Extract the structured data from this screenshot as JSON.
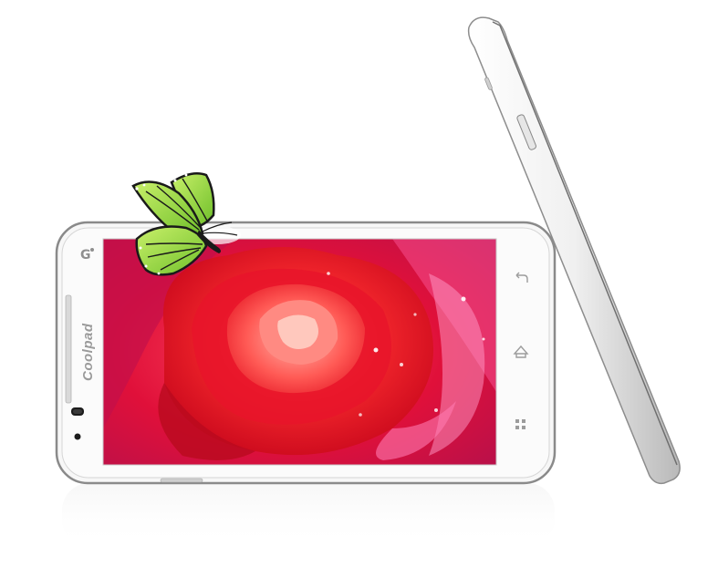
{
  "phone": {
    "brand_logo": "Coolpad",
    "front_mark": "G"
  },
  "colors": {
    "background": "#ffffff",
    "phone_body": "#f7f7f7",
    "phone_bezel": "#9a9a9a",
    "screen_rose": "#e8142a",
    "screen_background": "#d41436",
    "butterfly_wing": "#8fd23a"
  },
  "icons": {
    "nav_back": "back-arrow-icon",
    "nav_home": "home-icon",
    "nav_menu": "menu-grid-icon",
    "front_camera": "front-camera-icon",
    "sensor": "sensor-icon"
  }
}
